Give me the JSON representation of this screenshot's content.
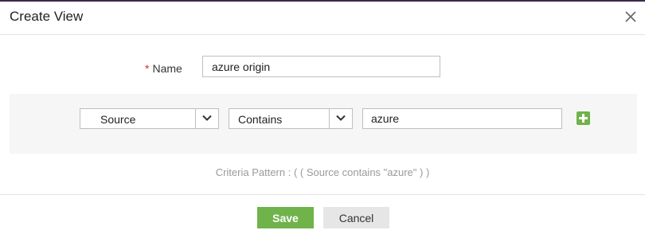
{
  "dialog": {
    "title": "Create View",
    "close_icon": "close-icon"
  },
  "name_field": {
    "required_mark": "*",
    "label": "Name",
    "value": "azure origin"
  },
  "criteria": {
    "field_select": {
      "value": "Source",
      "icon": "chevron-down-icon"
    },
    "operator_select": {
      "value": "Contains",
      "icon": "chevron-down-icon"
    },
    "value_input": "azure",
    "add_icon": "plus-icon",
    "add_color": "#6fb34a"
  },
  "criteria_pattern": "Criteria Pattern : ( ( Source contains \"azure\" ) )",
  "footer": {
    "save_label": "Save",
    "cancel_label": "Cancel",
    "save_color": "#6fb34a"
  }
}
